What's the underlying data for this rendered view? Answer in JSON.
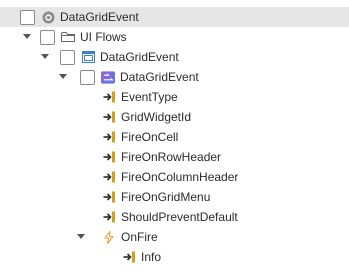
{
  "tree": {
    "nodes": [
      {
        "label": "DataGridEvent",
        "level": 0,
        "icon": "record-dot-icon",
        "expander": "none",
        "selected": true,
        "checkbox": true
      },
      {
        "label": "UI Flows",
        "level": 1,
        "icon": "folder-icon",
        "expander": "expanded",
        "selected": false,
        "checkbox": true
      },
      {
        "label": "DataGridEvent",
        "level": 2,
        "icon": "window-icon",
        "expander": "expanded",
        "selected": false,
        "checkbox": true
      },
      {
        "label": "DataGridEvent",
        "level": 3,
        "icon": "event-flow-icon",
        "expander": "expanded",
        "selected": false,
        "checkbox": true
      },
      {
        "label": "EventType",
        "level": 4,
        "icon": "input-parameter-icon",
        "expander": "none",
        "selected": false,
        "checkbox": false
      },
      {
        "label": "GridWidgetId",
        "level": 4,
        "icon": "input-parameter-icon",
        "expander": "none",
        "selected": false,
        "checkbox": false
      },
      {
        "label": "FireOnCell",
        "level": 4,
        "icon": "input-parameter-icon",
        "expander": "none",
        "selected": false,
        "checkbox": false
      },
      {
        "label": "FireOnRowHeader",
        "level": 4,
        "icon": "input-parameter-icon",
        "expander": "none",
        "selected": false,
        "checkbox": false
      },
      {
        "label": "FireOnColumnHeader",
        "level": 4,
        "icon": "input-parameter-icon",
        "expander": "none",
        "selected": false,
        "checkbox": false
      },
      {
        "label": "FireOnGridMenu",
        "level": 4,
        "icon": "input-parameter-icon",
        "expander": "none",
        "selected": false,
        "checkbox": false
      },
      {
        "label": "ShouldPreventDefault",
        "level": 4,
        "icon": "input-parameter-icon",
        "expander": "none",
        "selected": false,
        "checkbox": false
      },
      {
        "label": "OnFire",
        "level": 4,
        "icon": "lightning-icon",
        "expander": "expanded",
        "selected": false,
        "checkbox": false
      },
      {
        "label": "Info",
        "level": 5,
        "icon": "input-parameter-icon",
        "expander": "none",
        "selected": false,
        "checkbox": false
      }
    ]
  },
  "colors": {
    "selection": "#e6e6e6",
    "parameter_icon": "#d4a017",
    "lightning_icon": "#e8a33d",
    "window_icon": "#3a7fd5",
    "event_icon_start": "#9b5bd9",
    "event_icon_end": "#5a7be0",
    "folder_icon": "#666666"
  }
}
